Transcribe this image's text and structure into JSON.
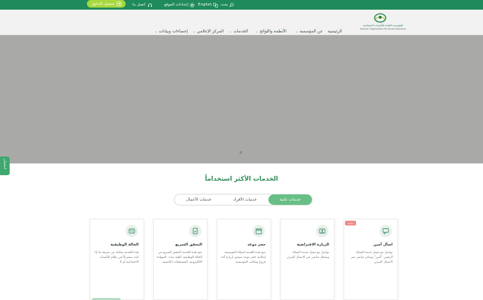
{
  "topbar": {
    "login_label": "تسجيل الدخول",
    "contact_label": "اتصل بنا",
    "settings_label": "إعدادات الموقع",
    "language_label": "English",
    "search_label": "بحث"
  },
  "logo": {
    "ar": "المؤسسـة العامـة للتأمينـات الاجتماعيـة",
    "en": "General Organization for Social Insurance"
  },
  "nav": {
    "items": [
      "الرئيسية",
      "عن المؤسسة",
      "الأنظمة واللوائح",
      "الخدمات",
      "المركز الإعلامي",
      "إحصاءات وبيانات"
    ]
  },
  "side_tab": {
    "label": "استبيان"
  },
  "services": {
    "title": "الخدمات الأكثر استخداماً",
    "tabs": [
      "خدمات عامة",
      "خدمات الأفراد",
      "خدمات الأعمال"
    ],
    "cards": [
      {
        "title": "اسأل أمين",
        "badge": "جديد",
        "icon": "chat-icon",
        "desc": "تواصل مع ممثل خدمة العملاء الرقمي \"أمين\" وتمكن مباشر عبر الاتصال المرئي"
      },
      {
        "title": "الزيارة الافتراضية",
        "icon": "video-call-icon",
        "desc": "تواصل مع ممثل خدمة العملاء وبشكل مباشر عبر الاتصال المرئي"
      },
      {
        "title": "حجز موعد",
        "icon": "calendar-icon",
        "desc": "تتيح هذه الخدمة لعملاء المؤسسة إمكانية حجز موعد مسبق لزيارة أحد فروع ومكاتب المؤسسة."
      },
      {
        "title": "التحقق السريع",
        "icon": "document-check-icon",
        "desc": "تتيح هذه الخدمة التحقق السريع من الحالة الوظيفية، أهلية ساند، الشهادة الالكترونية، المستحقات التأمينية."
      },
      {
        "title": "الحالة الوظيفية",
        "icon": "id-card-icon",
        "desc": "هذه الخدمة تمكنك من معرفة ما إذا كنت مشتركاً في نظام التأمينات الاجتماعية أم لا."
      }
    ]
  },
  "colors": {
    "brand_green": "#1f8a5b",
    "accent_lime": "#a7d83f",
    "tab_active": "#67bf85",
    "hero_gray": "#a9aaa8"
  }
}
